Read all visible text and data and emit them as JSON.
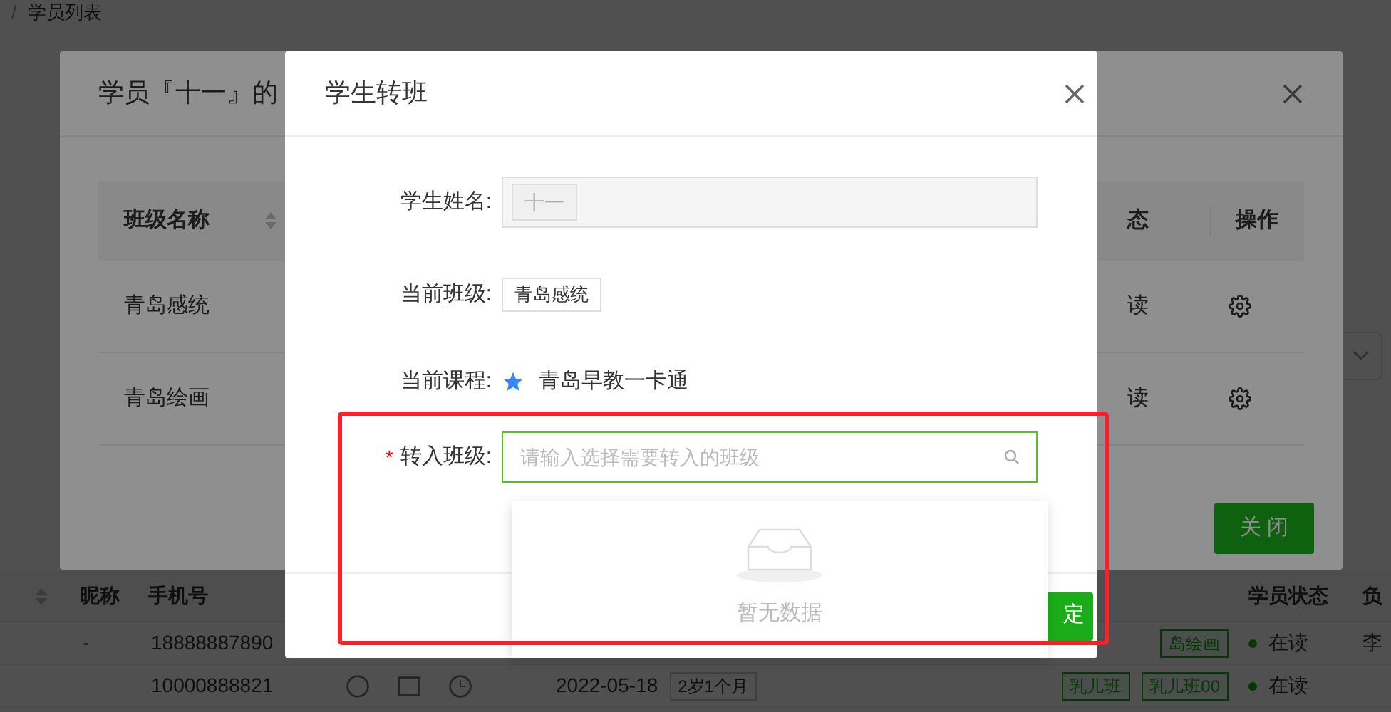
{
  "breadcrumb": {
    "separator": "/",
    "current": "学员列表"
  },
  "student_table": {
    "columns": [
      "昵称",
      "手机号",
      "学员状态",
      "负"
    ],
    "rows": [
      {
        "nickname": "-",
        "phone": "18888887890",
        "tags": [
          {
            "label": "岛绘画"
          }
        ],
        "status": "在读",
        "column_4": "李"
      },
      {
        "nickname": "",
        "phone": "10000888821",
        "date": "2022-05-18",
        "age": "2岁1个月",
        "tags": [
          {
            "label": "乳儿班"
          },
          {
            "label": "乳儿班00"
          }
        ],
        "status": "在读",
        "column_4": ""
      }
    ]
  },
  "class_dialog": {
    "title": "学员『十一』的",
    "columns": [
      "班级名称",
      "态",
      "操作"
    ],
    "rows": [
      {
        "class_name": "青岛感统",
        "status": "读"
      },
      {
        "class_name": "青岛绘画",
        "status": "读"
      }
    ],
    "close_button": "关 闭"
  },
  "transfer_dialog": {
    "title": "学生转班",
    "student_name": {
      "label": "学生姓名:",
      "value": "十一",
      "disabled": true
    },
    "current_class": {
      "label": "当前班级:",
      "value": "青岛感统"
    },
    "current_course": {
      "label": "当前课程:",
      "value": "青岛早教一卡通"
    },
    "target_class": {
      "label": "转入班级:",
      "required": true,
      "required_mark": "*",
      "placeholder": "请输入选择需要转入的班级",
      "focused": true
    },
    "dropdown": {
      "empty_text": "暂无数据"
    },
    "confirm_button": "定",
    "highlighted": true
  }
}
